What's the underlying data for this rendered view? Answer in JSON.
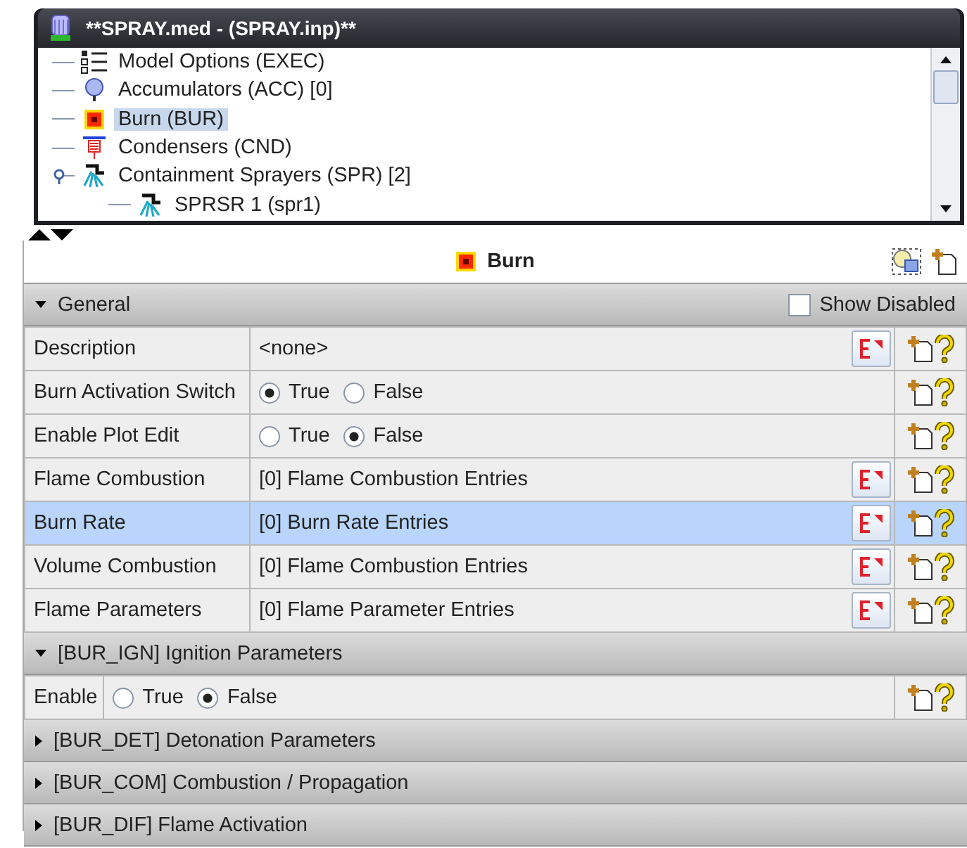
{
  "window": {
    "title": "**SPRAY.med - (SPRAY.inp)**"
  },
  "tree": [
    {
      "label": "Model Options (EXEC)",
      "kind": "options",
      "selected": false
    },
    {
      "label": "Accumulators (ACC) [0]",
      "kind": "accumulator",
      "selected": false
    },
    {
      "label": "Burn (BUR)",
      "kind": "burn",
      "selected": true
    },
    {
      "label": "Condensers (CND)",
      "kind": "condenser",
      "selected": false
    },
    {
      "label": "Containment Sprayers (SPR) [2]",
      "kind": "sprayer",
      "selected": false,
      "expanded": true,
      "children": [
        {
          "label": "SPRSR 1 (spr1)",
          "kind": "sprayer",
          "selected": false
        }
      ]
    }
  ],
  "panel": {
    "title": "Burn"
  },
  "sections": [
    {
      "title": "General",
      "expanded": true,
      "show_disabled": {
        "label": "Show Disabled",
        "checked": false
      },
      "rows": [
        {
          "label": "Description",
          "kind": "text",
          "value": "<none>",
          "selected": false
        },
        {
          "label": "Burn Activation Switch",
          "kind": "radio",
          "selected": false,
          "options": [
            {
              "label": "True",
              "selected": true
            },
            {
              "label": "False",
              "selected": false
            }
          ]
        },
        {
          "label": "Enable Plot Edit",
          "kind": "radio",
          "selected": false,
          "options": [
            {
              "label": "True",
              "selected": false
            },
            {
              "label": "False",
              "selected": true
            }
          ]
        },
        {
          "label": "Flame Combustion",
          "kind": "text",
          "value": "[0] Flame Combustion Entries",
          "selected": false
        },
        {
          "label": "Burn Rate",
          "kind": "text",
          "value": "[0] Burn Rate Entries",
          "selected": true
        },
        {
          "label": "Volume Combustion",
          "kind": "text",
          "value": "[0] Flame Combustion Entries",
          "selected": false
        },
        {
          "label": "Flame Parameters",
          "kind": "text",
          "value": "[0] Flame Parameter Entries",
          "selected": false
        }
      ]
    },
    {
      "title": "[BUR_IGN] Ignition Parameters",
      "expanded": true,
      "rows": [
        {
          "label": "Enable",
          "kind": "radio",
          "selected": false,
          "options": [
            {
              "label": "True",
              "selected": false
            },
            {
              "label": "False",
              "selected": true
            }
          ]
        }
      ]
    },
    {
      "title": "[BUR_DET] Detonation Parameters",
      "expanded": false
    },
    {
      "title": "[BUR_COM] Combustion / Propagation",
      "expanded": false
    },
    {
      "title": "[BUR_DIF] Flame Activation",
      "expanded": false
    }
  ]
}
